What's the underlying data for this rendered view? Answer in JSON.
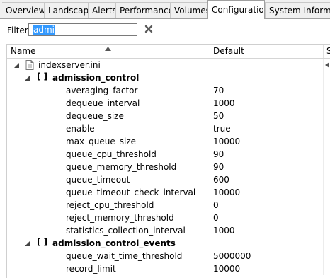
{
  "tabs": [
    {
      "label": "Overview",
      "active": false
    },
    {
      "label": "Landscape",
      "active": false
    },
    {
      "label": "Alerts",
      "active": false
    },
    {
      "label": "Performance",
      "active": false
    },
    {
      "label": "Volumes",
      "active": false
    },
    {
      "label": "Configuration",
      "active": true
    },
    {
      "label": "System Informat",
      "active": false
    }
  ],
  "filter": {
    "label": "Filter:",
    "value": "admi"
  },
  "table": {
    "columns": {
      "name": "Name",
      "default": "Default",
      "third": "S"
    },
    "rows": [
      {
        "kind": "file",
        "name": "indexserver.ini",
        "value": ""
      },
      {
        "kind": "section",
        "name": "admission_control",
        "value": ""
      },
      {
        "kind": "param",
        "name": "averaging_factor",
        "value": "70"
      },
      {
        "kind": "param",
        "name": "dequeue_interval",
        "value": "1000"
      },
      {
        "kind": "param",
        "name": "dequeue_size",
        "value": "50"
      },
      {
        "kind": "param",
        "name": "enable",
        "value": "true"
      },
      {
        "kind": "param",
        "name": "max_queue_size",
        "value": "10000"
      },
      {
        "kind": "param",
        "name": "queue_cpu_threshold",
        "value": "90"
      },
      {
        "kind": "param",
        "name": "queue_memory_threshold",
        "value": "90"
      },
      {
        "kind": "param",
        "name": "queue_timeout",
        "value": "600"
      },
      {
        "kind": "param",
        "name": "queue_timeout_check_interval",
        "value": "10000"
      },
      {
        "kind": "param",
        "name": "reject_cpu_threshold",
        "value": "0"
      },
      {
        "kind": "param",
        "name": "reject_memory_threshold",
        "value": "0"
      },
      {
        "kind": "param",
        "name": "statistics_collection_interval",
        "value": "1000"
      },
      {
        "kind": "section",
        "name": "admission_control_events",
        "value": ""
      },
      {
        "kind": "param",
        "name": "queue_wait_time_threshold",
        "value": "5000000"
      },
      {
        "kind": "param",
        "name": "record_limit",
        "value": "10000"
      }
    ],
    "section_bracket": "[ ]"
  },
  "colors": {
    "selection": "#3399ff",
    "clear_icon": "#5a5a5a",
    "tab_border": "#a0a0a0"
  },
  "icons": {
    "clear": "x-icon",
    "sort": "sort-asc-icon",
    "tree": "expanded-triangle-icon",
    "file": "ini-file-icon"
  }
}
